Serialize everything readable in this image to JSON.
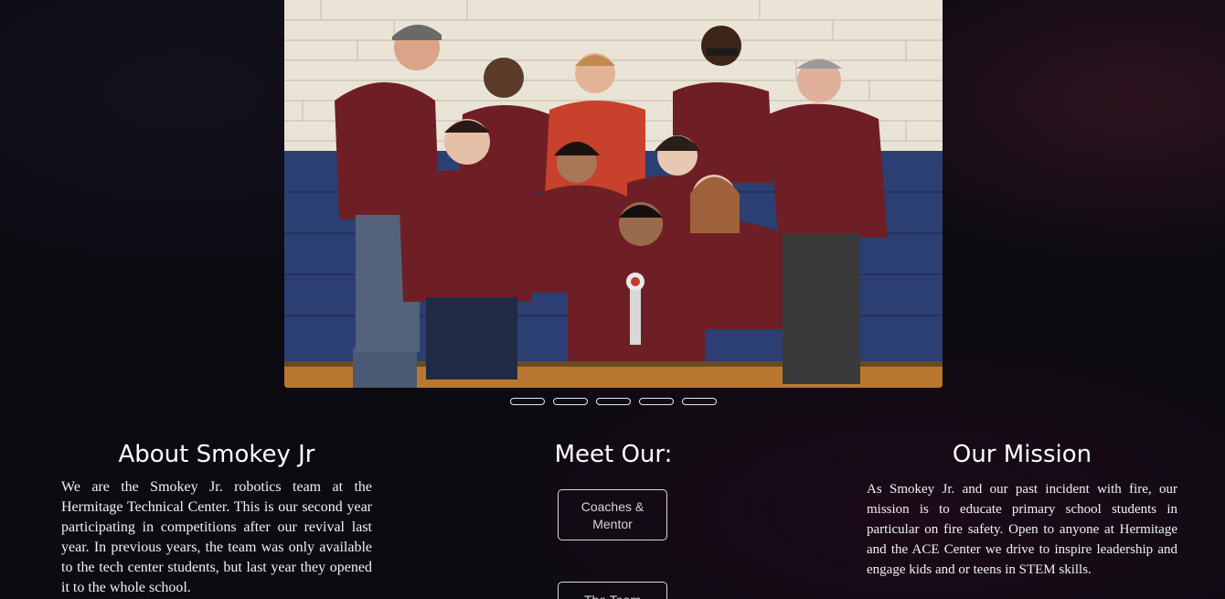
{
  "carousel": {
    "slide_count": 5,
    "active_index": 0
  },
  "about": {
    "title": "About Smokey Jr",
    "text": "We are the Smokey Jr. robotics team at the Hermitage Technical Center. This is our second year participating in competitions after our revival last year. In previous years, the team was only available to the tech center students, but last year they opened it to the whole school."
  },
  "meet": {
    "title": "Meet Our:",
    "buttons": [
      "Coaches & Mentor",
      "The Team"
    ]
  },
  "mission": {
    "title": "Our Mission",
    "text": "As Smokey Jr. and our past incident with fire, our mission is to educate primary school students in particular on fire safety. Open to anyone at Hermitage and the ACE Center we drive to inspire leadership and engage kids and or teens in STEM skills."
  },
  "colors": {
    "background": "#0d0b12",
    "shirt_maroon": "#6e1f26",
    "wall_blue": "#2c3f73",
    "text": "#ffffff"
  }
}
